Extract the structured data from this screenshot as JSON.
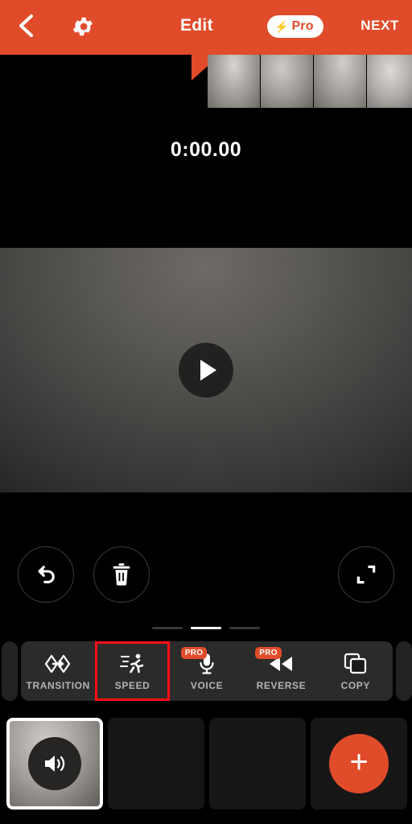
{
  "header": {
    "back_icon": "chevron-left-icon",
    "settings_icon": "gear-icon",
    "title": "Edit",
    "pro_badge": {
      "bolt": "⚡",
      "label": "Pro"
    },
    "next_label": "NEXT"
  },
  "filmstrip": {
    "thumbnails": [
      "frame-1",
      "frame-2",
      "frame-3",
      "frame-4"
    ]
  },
  "player": {
    "timecode": "0:00.00",
    "play_icon": "play-icon"
  },
  "actions": [
    {
      "name": "undo-button",
      "icon": "undo-arrow-icon"
    },
    {
      "name": "delete-button",
      "icon": "trash-icon"
    },
    {
      "name": "expand-button",
      "icon": "fullscreen-expand-icon"
    }
  ],
  "pager": {
    "count": 3,
    "active_index": 1
  },
  "toolbar": {
    "items": [
      {
        "label": "TRANSITION",
        "icon": "transition-icon",
        "pro": false,
        "highlighted": false
      },
      {
        "label": "SPEED",
        "icon": "running-person-icon",
        "pro": false,
        "highlighted": true
      },
      {
        "label": "VOICE",
        "icon": "microphone-icon",
        "pro": true,
        "highlighted": false
      },
      {
        "label": "REVERSE",
        "icon": "reverse-play-icon",
        "pro": true,
        "highlighted": false
      },
      {
        "label": "COPY",
        "icon": "copy-icon",
        "pro": false,
        "highlighted": false
      }
    ],
    "pro_tag_label": "PRO"
  },
  "timeline": {
    "clips": [
      {
        "name": "clip-1",
        "selected": true,
        "icon": "speaker-icon"
      },
      {
        "name": "clip-2",
        "selected": false,
        "icon": ""
      },
      {
        "name": "clip-3",
        "selected": false,
        "icon": ""
      }
    ],
    "add_label": "+"
  },
  "colors": {
    "accent": "#e04b2a",
    "highlight_box": "#ff0f18",
    "background": "#000000",
    "toolbar_bg": "#2b2b2b"
  }
}
